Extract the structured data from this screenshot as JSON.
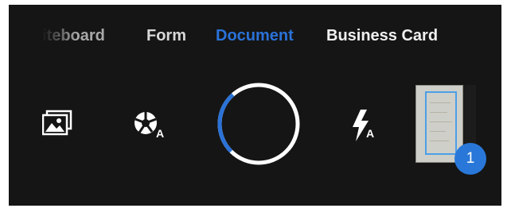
{
  "modes": [
    {
      "label": "iteboard",
      "state": "faded"
    },
    {
      "label": "Form",
      "state": "normal"
    },
    {
      "label": "Document",
      "state": "active"
    },
    {
      "label": "Business Card",
      "state": "normal"
    }
  ],
  "controls": {
    "gallery_icon": "gallery-icon",
    "auto_capture_icon": "auto-capture-icon",
    "flash_icon": "flash-auto-icon",
    "auto_letter": "A",
    "flash_letter": "A"
  },
  "shutter": {
    "progress": 0.26,
    "ring_color": "#ffffff",
    "progress_color": "#2a72d8"
  },
  "thumbnail": {
    "badge_count": "1"
  },
  "colors": {
    "background": "#151515",
    "accent": "#2a72d8",
    "badge": "#2978d9"
  }
}
